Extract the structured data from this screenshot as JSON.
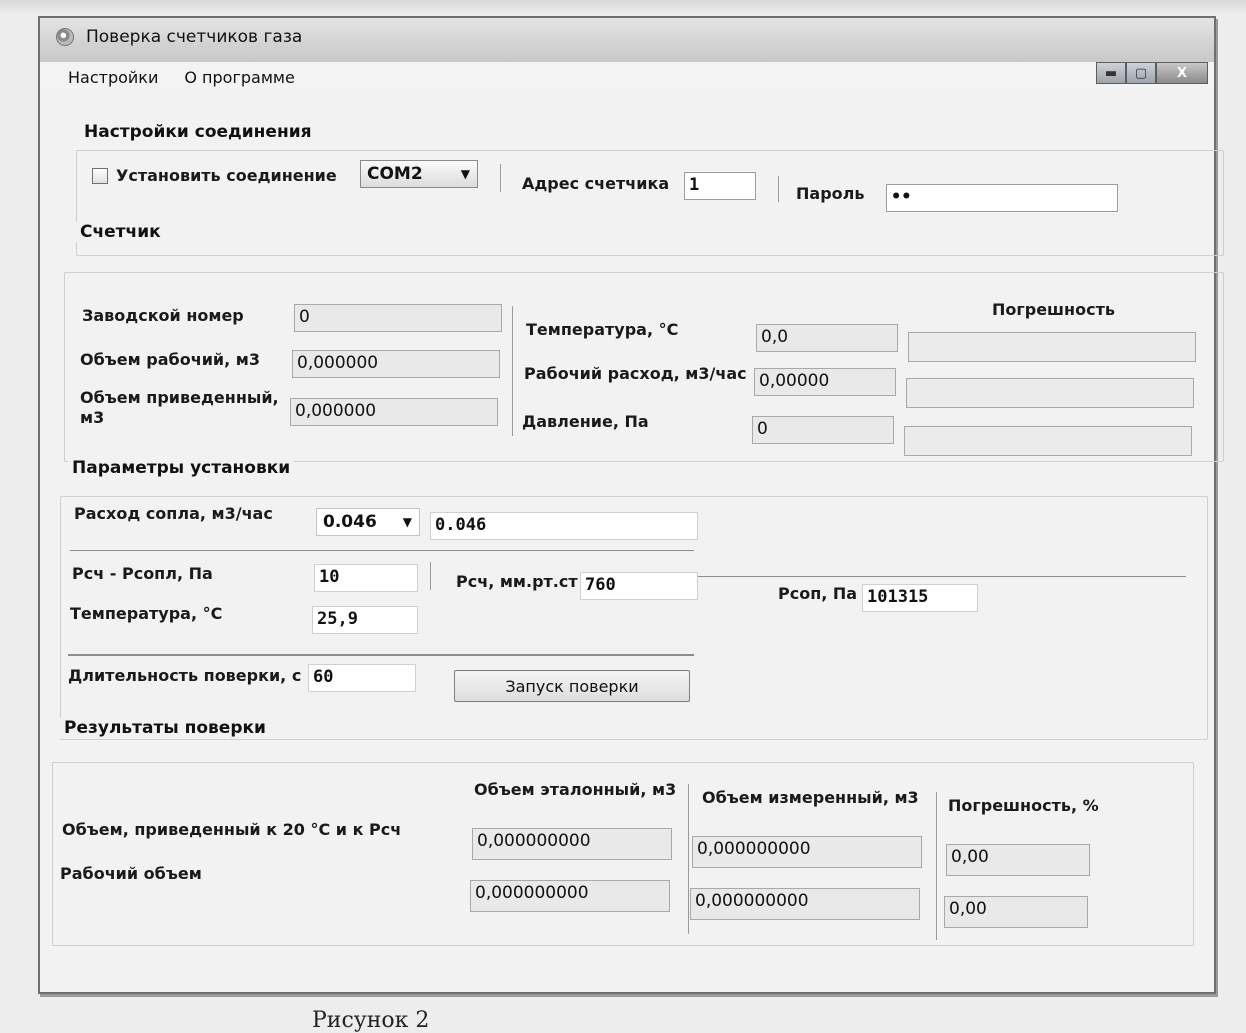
{
  "window": {
    "title": "Поверка счетчиков газа",
    "controls": {
      "minimize": "▬",
      "maximize": "▢",
      "close": "X"
    }
  },
  "menu": [
    "Настройки",
    "О программе"
  ],
  "connection": {
    "group_title": "Настройки соединения",
    "checkbox_label": "Установить соединение",
    "checked": false,
    "port": "COM2",
    "address_label": "Адрес счетчика",
    "address_value": "1",
    "password_label": "Пароль",
    "password_value": "••"
  },
  "counter": {
    "group_title": "Счетчик",
    "serial_label": "Заводской номер",
    "serial_value": "0",
    "vol_work_label": "Объем рабочий, м3",
    "vol_work_value": "0,000000",
    "vol_norm_label": "Объем приведенный,",
    "vol_norm_label2": "м3",
    "vol_norm_value": "0,000000",
    "error_header": "Погрешность",
    "temp_label": "Температура, °С",
    "temp_value": "0,0",
    "flow_label": "Рабочий расход, м3/час",
    "flow_value": "0,00000",
    "pressure_label": "Давление, Па",
    "pressure_value": "0"
  },
  "setup": {
    "group_title": "Параметры установки",
    "nozzle_label": "Расход сопла, м3/час",
    "nozzle_select": "0.046",
    "nozzle_value": "0.046",
    "dp_label": "Рсч - Рсопл, Па",
    "dp_value": "10",
    "pmm_label": "Рсч, мм.рт.ст",
    "pmm_value": "760",
    "psop_label": "Рсоп, Па",
    "psop_value": "101315",
    "temp_label": "Температура, °С",
    "temp_value": "25,9",
    "duration_label": "Длительность поверки, с",
    "duration_value": "60",
    "start_button": "Запуск поверки"
  },
  "results": {
    "group_title": "Результаты поверки",
    "col_ref": "Объем эталонный, м3",
    "col_meas": "Объем измеренный, м3",
    "col_err": "Погрешность, %",
    "rows": [
      {
        "label": "Объем, приведенный к 20 °С и к Рсч",
        "ref": "0,000000000",
        "meas": "0,000000000",
        "err": "0,00"
      },
      {
        "label": "Рабочий объем",
        "ref": "0,000000000",
        "meas": "0,000000000",
        "err": "0,00"
      }
    ]
  },
  "caption": "Рисунок 2"
}
